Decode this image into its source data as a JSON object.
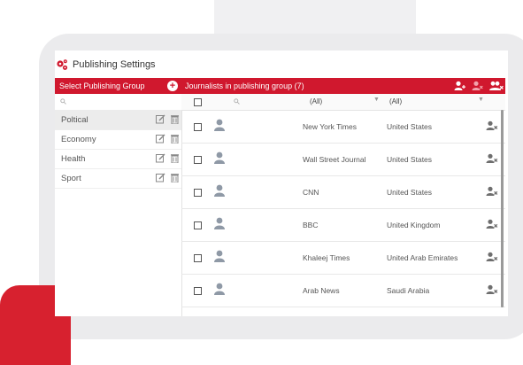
{
  "window": {
    "title": "Publishing Settings",
    "icon": "gears-icon"
  },
  "left_panel": {
    "header": "Select Publishing Group",
    "add_icon": "plus-circle-icon",
    "search_icon": "search-icon",
    "groups": [
      {
        "label": "Poltical",
        "active": true
      },
      {
        "label": "Economy",
        "active": false
      },
      {
        "label": "Health",
        "active": false
      },
      {
        "label": "Sport",
        "active": false
      }
    ]
  },
  "right_panel": {
    "header": "Journalists in publishing group (7)",
    "header_icons": [
      "add-user-icon",
      "remove-user-icon",
      "remove-users-icon"
    ],
    "filters": {
      "publication": "(All)",
      "country": "(All)"
    },
    "rows": [
      {
        "publication": "New York Times",
        "country": "United States"
      },
      {
        "publication": "Wall Street Journal",
        "country": "United States"
      },
      {
        "publication": "CNN",
        "country": "United States"
      },
      {
        "publication": "BBC",
        "country": "United Kingdom"
      },
      {
        "publication": "Khaleej Times",
        "country": "United Arab Emirates"
      },
      {
        "publication": "Arab News",
        "country": "Saudi Arabia"
      }
    ]
  },
  "colors": {
    "accent": "#d0182e",
    "frame": "#ebebed",
    "red_shape": "#d7212f"
  }
}
